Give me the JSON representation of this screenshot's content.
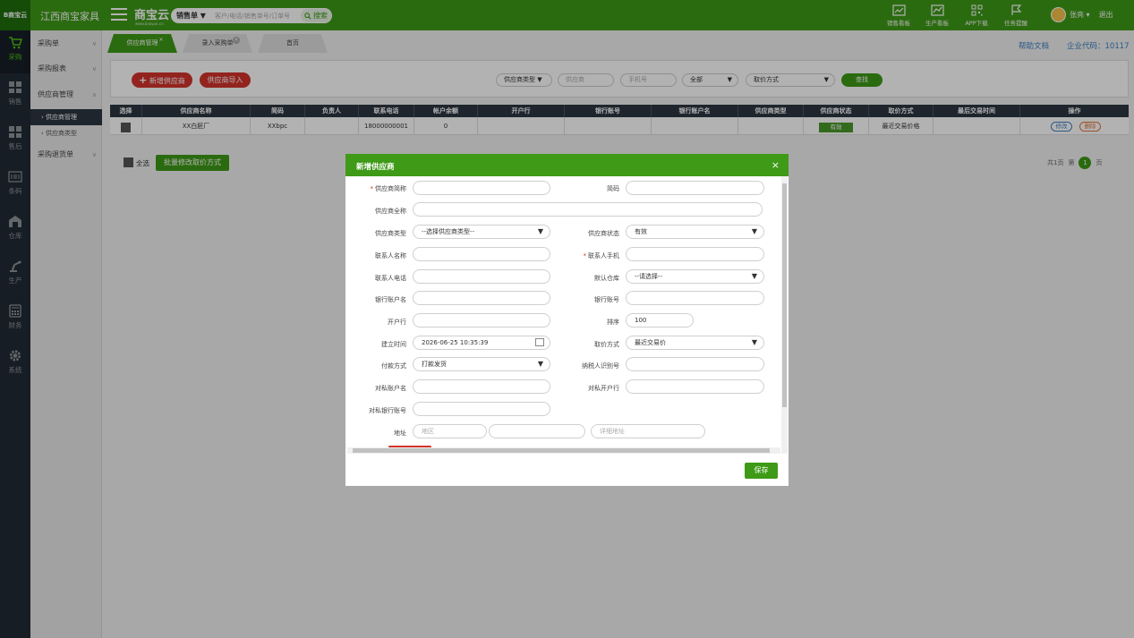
{
  "topbar": {
    "logo_text": "B商宝云",
    "company": "江西商宝家具",
    "brand": "商宝云",
    "brand_sub": "www.baoyun.cn",
    "search_type": "销售单 ▼",
    "search_placeholder": "客户/电话/销售单号/订单号",
    "search_button": "搜索",
    "icons": [
      {
        "name": "sales-board-icon",
        "label": "销售看板"
      },
      {
        "name": "production-board-icon",
        "label": "生产看板"
      },
      {
        "name": "app-download-icon",
        "label": "APP下载"
      },
      {
        "name": "task-reminder-icon",
        "label": "任务提醒"
      }
    ],
    "user": "张亮 ▾",
    "logout": "退出"
  },
  "leftnav": [
    {
      "name": "purchase",
      "label": "采购",
      "active": true
    },
    {
      "name": "sales",
      "label": "销售"
    },
    {
      "name": "after-sales",
      "label": "售后"
    },
    {
      "name": "bar-code",
      "label": "条码"
    },
    {
      "name": "warehouse",
      "label": "仓库"
    },
    {
      "name": "production",
      "label": "生产"
    },
    {
      "name": "finance",
      "label": "财务"
    },
    {
      "name": "system",
      "label": "系统"
    }
  ],
  "submenu": {
    "purchase_order": "采购单",
    "purchase_report": "采购报表",
    "supplier_mgmt": "供应商管理",
    "supplier_mgmt_sub": "› 供应商管理",
    "supplier_type_sub": "› 供应商类型",
    "purchase_return": "采购退货单"
  },
  "tabs": [
    {
      "label": "供应商管理",
      "active": true
    },
    {
      "label": "录入采购单",
      "active": false
    },
    {
      "label": "首页",
      "active": false
    }
  ],
  "header_links": {
    "help": "帮助文档",
    "corp_code": "企业代码：10117"
  },
  "toolbar": {
    "add_supplier": "新增供应商",
    "import_supplier": "供应商导入",
    "supplier_type": "供应商类型 ▼",
    "supplier_placeholder": "供应商",
    "phone_placeholder": "手机号",
    "scope": "全部",
    "price_method": "取价方式",
    "find": "查找"
  },
  "table": {
    "headers": [
      "选择",
      "供应商名称",
      "简码",
      "负责人",
      "联系电话",
      "帐户余额",
      "开户行",
      "银行账号",
      "银行账户名",
      "供应商类型",
      "供应商状态",
      "取价方式",
      "最后交易时间",
      "操作"
    ],
    "rows": [
      {
        "name": "XX白胚厂",
        "code": "XXbpc",
        "owner": "",
        "phone": "18000000001",
        "balance": "0",
        "bank": "",
        "account": "",
        "account_name": "",
        "type": "",
        "status": "有效",
        "price_method": "最近交易价格",
        "last_trade": "",
        "edit": "修改",
        "delete": "删除"
      }
    ]
  },
  "footer": {
    "select_all": "全选",
    "batch_modify": "批量修改取价方式",
    "pager_total": "共1页",
    "pager_prefix": "第",
    "pager_current": "1",
    "pager_suffix": "页"
  },
  "modal": {
    "title": "新增供应商",
    "close": "×",
    "fields": {
      "short_name_label": "供应商简称",
      "code_label": "简码",
      "full_name_label": "供应商全称",
      "type_label": "供应商类型",
      "type_value": "--选择供应商类型--",
      "status_label": "供应商状态",
      "status_value": "有效",
      "contact_label": "联系人名称",
      "mobile_label": "联系人手机",
      "phone_label": "联系人电话",
      "warehouse_label": "默认仓库",
      "warehouse_value": "--请选择--",
      "bank_account_name_label": "银行账户名",
      "bank_account_label": "银行账号",
      "bank_label": "开户行",
      "sort_label": "排序",
      "sort_value": "100",
      "created_label": "建立时间",
      "created_value": "2026-06-25 10:35:39",
      "price_label": "取价方式",
      "price_value": "最近交易价",
      "payment_label": "付款方式",
      "payment_value": "打款发货",
      "tax_id_label": "纳税人识别号",
      "private_account_name_label": "对私账户名",
      "private_bank_label": "对私开户行",
      "private_bank_account_label": "对私银行账号",
      "address_label": "地址",
      "region_placeholder": "地区",
      "detail_placeholder": "详细地址"
    },
    "save": "保存"
  }
}
